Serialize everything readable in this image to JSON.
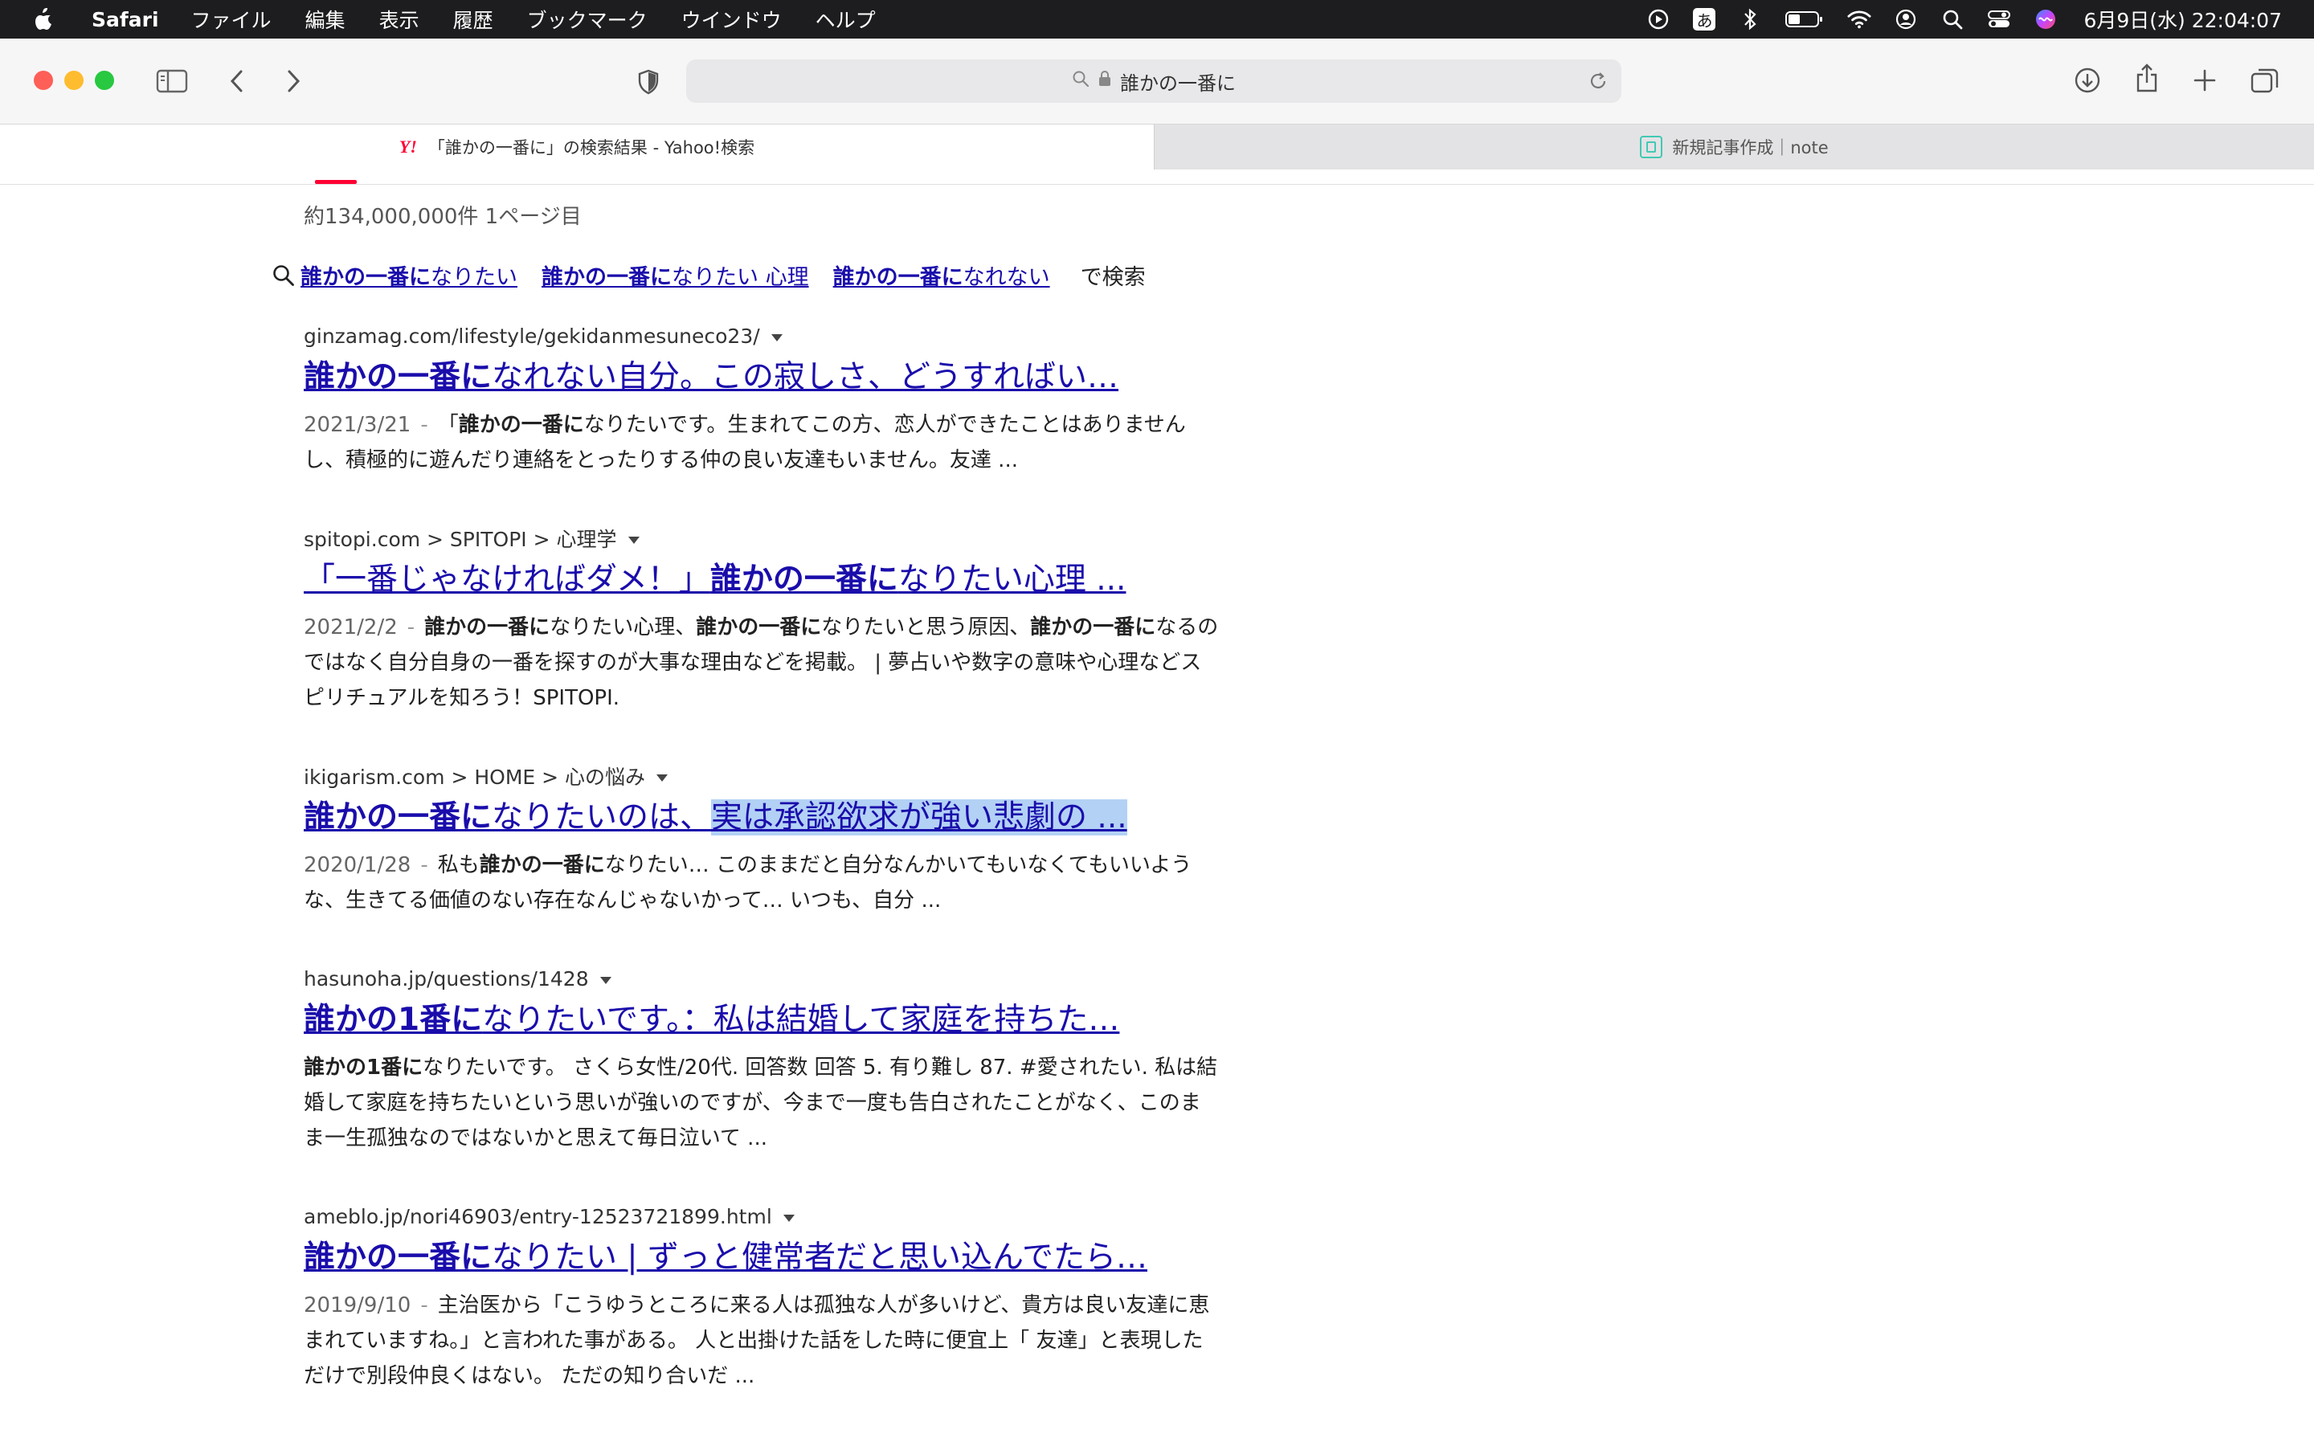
{
  "menubar": {
    "app_name": "Safari",
    "menus": [
      "ファイル",
      "編集",
      "表示",
      "履歴",
      "ブックマーク",
      "ウインドウ",
      "ヘルプ"
    ],
    "ime": "あ",
    "clock": "6月9日(水)  22:04:07"
  },
  "toolbar": {
    "address": "誰かの一番に"
  },
  "tabs": [
    {
      "label": "「誰かの一番に」の検索結果 - Yahoo!検索",
      "favicon": "Y!"
    },
    {
      "label": "新規記事作成｜note"
    }
  ],
  "results_info": "約134,000,000件  1ページ目",
  "related": {
    "links": [
      {
        "bold": "誰かの一番に",
        "rest": "なりたい"
      },
      {
        "bold": "誰かの一番に",
        "rest": "なりたい 心理"
      },
      {
        "bold": "誰かの一番に",
        "rest": "なれない"
      }
    ],
    "suffix": "で検索"
  },
  "results": [
    {
      "url": "ginzamag.com/lifestyle/gekidanmesuneco23/",
      "title_bold": "誰かの一番に",
      "title_rest": "なれない自分。この寂しさ、どうすればい…",
      "date": "2021/3/21",
      "desc_pre": "「",
      "desc_bold": "誰かの一番に",
      "desc_rest": "なりたいです。生まれてこの方、恋人ができたことはありませんし、積極的に遊んだり連絡をとったりする仲の良い友達もいません。友達 ..."
    },
    {
      "url": "spitopi.com > SPITOPI > 心理学",
      "title_pre": "「一番じゃなければダメ！」",
      "title_bold": "誰かの一番に",
      "title_rest": "なりたい心理 ...",
      "date": "2021/2/2",
      "desc_bold": "誰かの一番に",
      "desc_rest1": "なりたい心理、",
      "desc_bold2": "誰かの一番に",
      "desc_rest2": "なりたいと思う原因、",
      "desc_bold3": "誰かの一番に",
      "desc_rest3": "なるのではなく自分自身の一番を探すのが大事な理由などを掲載。 | 夢占いや数字の意味や心理などスピリチュアルを知ろう！SPITOPI."
    },
    {
      "url": "ikigarism.com > HOME > 心の悩み",
      "title_bold": "誰かの一番に",
      "title_rest": "なりたいのは、",
      "title_hl": "実は承認欲求が強い悲劇の ...",
      "date": "2020/1/28",
      "desc_pre": "私も",
      "desc_bold": "誰かの一番に",
      "desc_rest": "なりたい… このままだと自分なんかいてもいなくてもいいような、生きてる価値のない存在なんじゃないかって… いつも、自分 ..."
    },
    {
      "url": "hasunoha.jp/questions/1428",
      "title_bold": "誰かの1番に",
      "title_rest": "なりたいです。：私は結婚して家庭を持ちた…",
      "desc_bold": "誰かの1番に",
      "desc_rest": "なりたいです。 さくら女性/20代. 回答数 回答 5. 有り難し 87. #愛されたい. 私は結婚して家庭を持ちたいという思いが強いのですが、今まで一度も告白されたことがなく、このまま一生孤独なのではないかと思えて毎日泣いて ..."
    },
    {
      "url": "ameblo.jp/nori46903/entry-12523721899.html",
      "title_bold": "誰かの一番に",
      "title_rest": "なりたい | ずっと健常者だと思い込んでたら…",
      "date": "2019/9/10",
      "desc_rest": "主治医から「こうゆうところに来る人は孤独な人が多いけど、貴方は良い友達に恵まれていますね。」と言われた事がある。 人と出掛けた話をした時に便宜上「 友達」と表現しただけで別段仲良くはない。 ただの知り合いだ ..."
    }
  ]
}
